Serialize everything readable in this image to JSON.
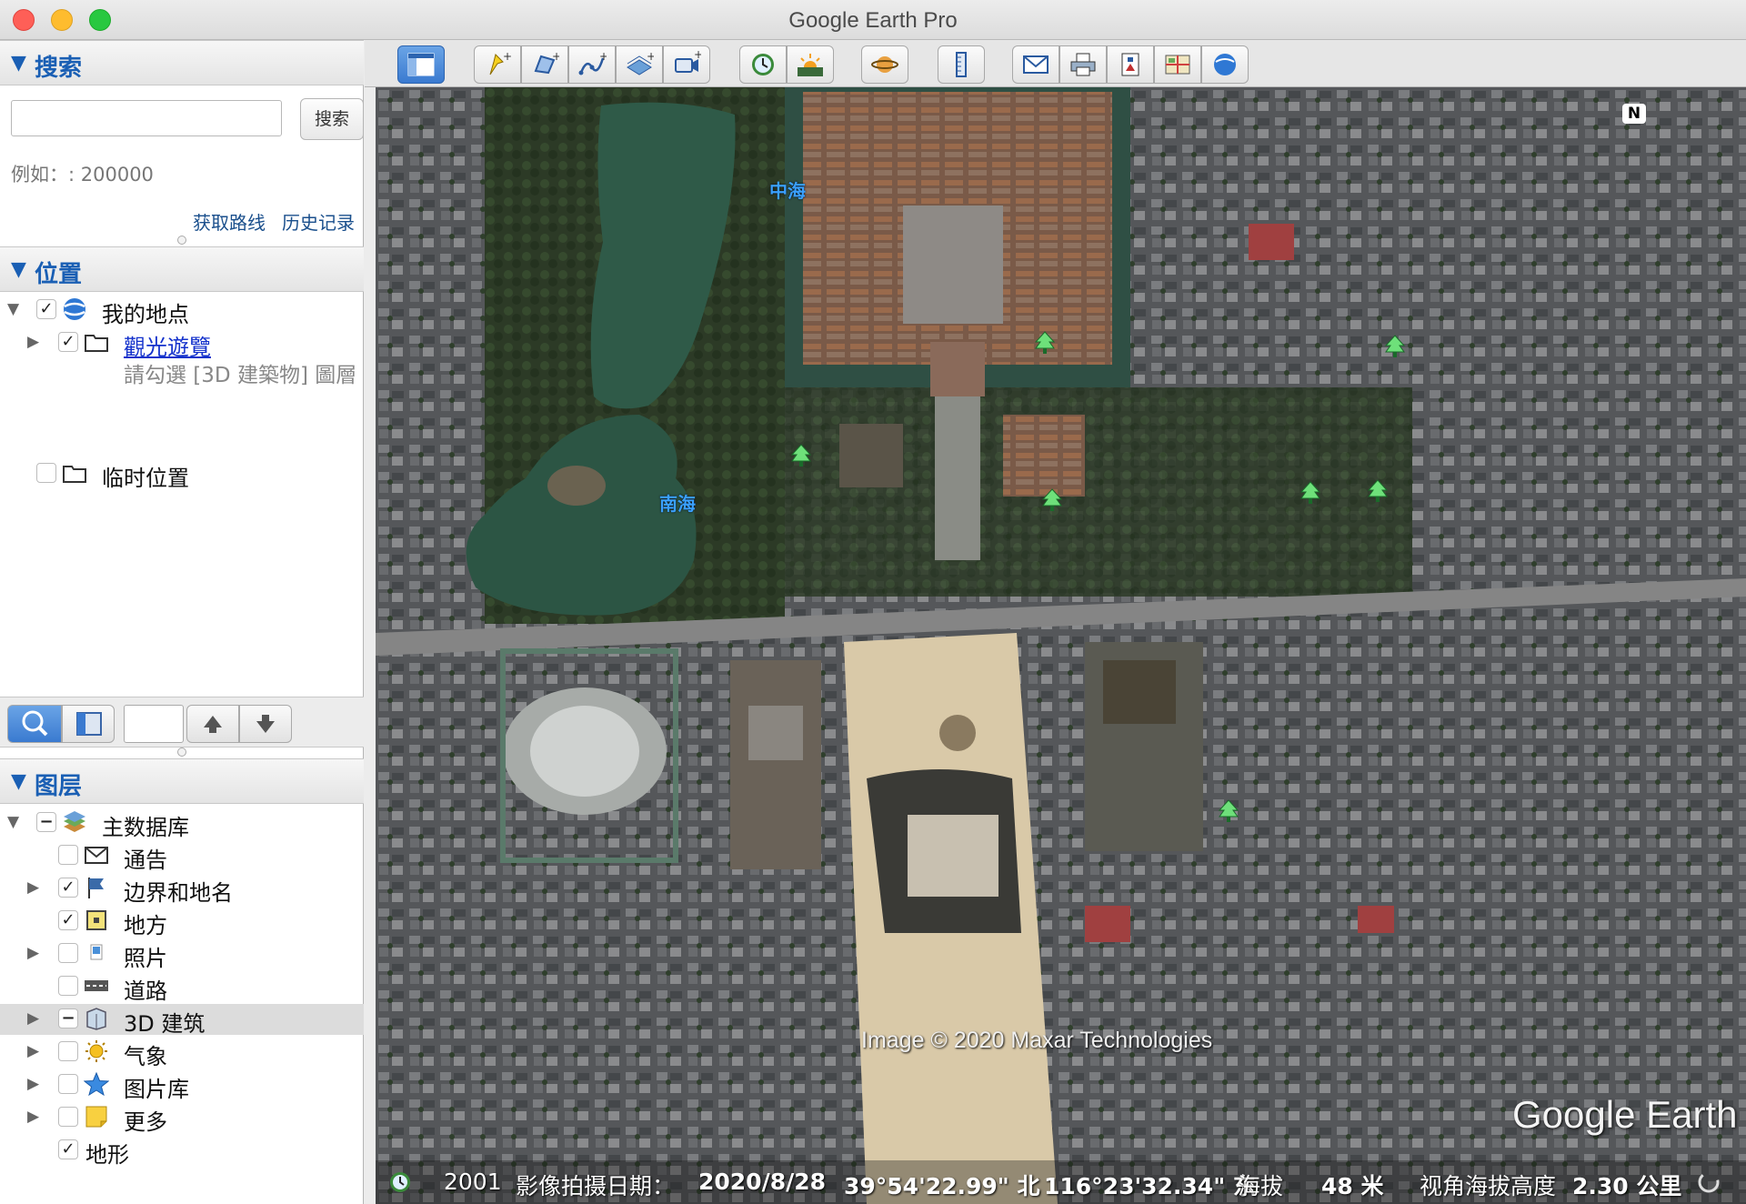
{
  "window": {
    "title": "Google Earth Pro"
  },
  "search": {
    "header": "搜索",
    "button": "搜索",
    "placeholder": "",
    "example": "例如：: 200000",
    "get_route": "获取路线",
    "history": "历史记录"
  },
  "places": {
    "header": "位置",
    "my_places": "我的地点",
    "tour": "觀光遊覽",
    "tour_note": "請勾選 [3D 建築物] 圖層",
    "temp_places": "临时位置"
  },
  "layers": {
    "header": "图层",
    "items": [
      {
        "label": "主数据库",
        "icon": "database-icon"
      },
      {
        "label": "通告",
        "icon": "envelope-icon"
      },
      {
        "label": "边界和地名",
        "icon": "flag-icon"
      },
      {
        "label": "地方",
        "icon": "place-icon"
      },
      {
        "label": "照片",
        "icon": "photo-icon"
      },
      {
        "label": "道路",
        "icon": "road-icon"
      },
      {
        "label": "3D 建筑",
        "icon": "building-3d-icon"
      },
      {
        "label": "气象",
        "icon": "sun-icon"
      },
      {
        "label": "图片库",
        "icon": "star-icon"
      },
      {
        "label": "更多",
        "icon": "note-icon"
      },
      {
        "label": "地形",
        "icon": ""
      }
    ]
  },
  "map": {
    "labels": {
      "zhonghai": "中海",
      "nanhai": "南海"
    },
    "copyright": "Image © 2020 Maxar Technologies",
    "brand": "Google Earth",
    "compass": "N",
    "status": {
      "year": "2001",
      "capture_label": "影像拍摄日期：",
      "capture_date": "2020/8/28",
      "lat": "39°54'22.99\" 北",
      "lon": "116°23'32.34\" 东",
      "elev_label": "海拔",
      "elev_value": "48 米",
      "eye_label": "视角海拔高度",
      "eye_value": "2.30 公里"
    }
  },
  "colors": {
    "accent": "#1a5fb4",
    "water": "#2f5a48",
    "square": "#d9c9a8"
  }
}
